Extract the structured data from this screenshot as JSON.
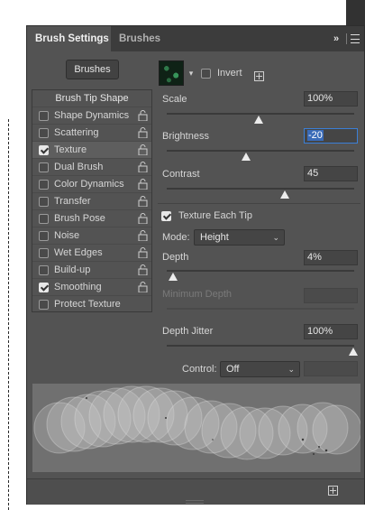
{
  "tabs": {
    "active": "Brush Settings",
    "inactive": "Brushes"
  },
  "menu": {
    "chevron": "»"
  },
  "brushes_button": "Brushes",
  "brush_options": {
    "header": "Brush Tip Shape",
    "items": [
      {
        "label": "Shape Dynamics",
        "checked": false,
        "selected": false
      },
      {
        "label": "Scattering",
        "checked": false,
        "selected": false
      },
      {
        "label": "Texture",
        "checked": true,
        "selected": true
      },
      {
        "label": "Dual Brush",
        "checked": false,
        "selected": false
      },
      {
        "label": "Color Dynamics",
        "checked": false,
        "selected": false
      },
      {
        "label": "Transfer",
        "checked": false,
        "selected": false
      },
      {
        "label": "Brush Pose",
        "checked": false,
        "selected": false
      },
      {
        "label": "Noise",
        "checked": false,
        "selected": false
      },
      {
        "label": "Wet Edges",
        "checked": false,
        "selected": false
      },
      {
        "label": "Build-up",
        "checked": false,
        "selected": false
      },
      {
        "label": "Smoothing",
        "checked": true,
        "selected": false
      },
      {
        "label": "Protect Texture",
        "checked": false,
        "selected": false
      }
    ]
  },
  "texture": {
    "invert_label": "Invert",
    "invert_checked": false,
    "scale": {
      "label": "Scale",
      "value": "100%"
    },
    "brightness": {
      "label": "Brightness",
      "value": "-20"
    },
    "contrast": {
      "label": "Contrast",
      "value": "45"
    },
    "each_tip": {
      "label": "Texture Each Tip",
      "checked": true
    },
    "mode": {
      "label": "Mode:",
      "value": "Height"
    },
    "depth": {
      "label": "Depth",
      "value": "4%"
    },
    "min_depth": {
      "label": "Minimum Depth",
      "value": ""
    },
    "depth_jitter": {
      "label": "Depth Jitter",
      "value": "100%"
    },
    "control": {
      "label": "Control:",
      "value": "Off"
    }
  },
  "colors": {
    "panel": "#535353",
    "accent": "#3b7fd6",
    "tabbar": "#3c3c3c"
  }
}
